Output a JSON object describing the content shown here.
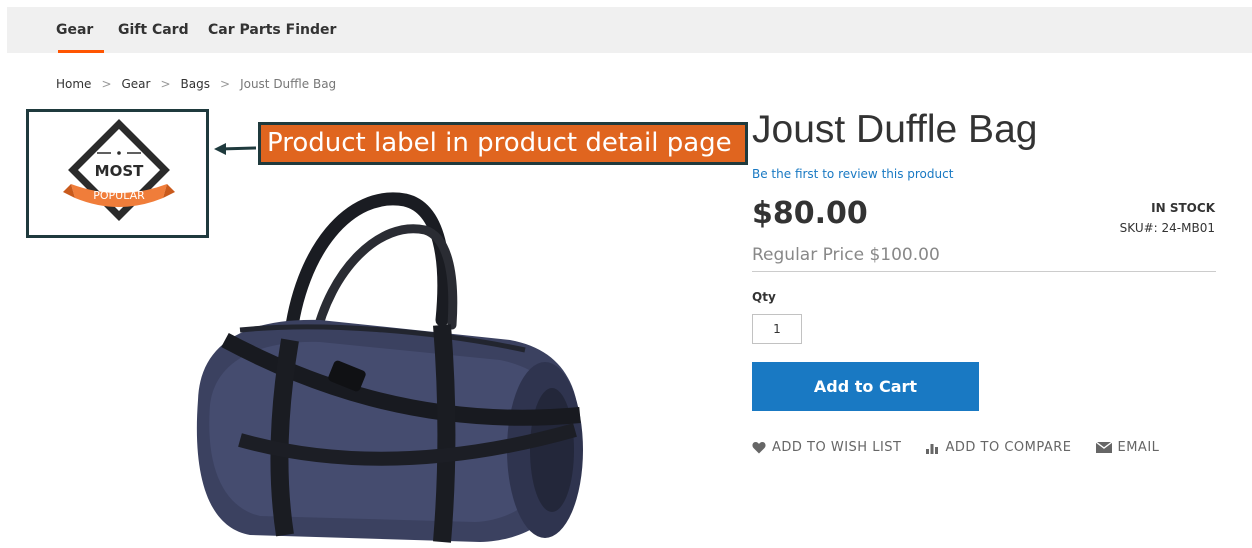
{
  "nav": {
    "items": [
      {
        "label": "Gear"
      },
      {
        "label": "Gift Card"
      },
      {
        "label": "Car Parts Finder"
      }
    ]
  },
  "breadcrumb": {
    "items": [
      "Home",
      "Gear",
      "Bags"
    ],
    "current": "Joust Duffle Bag",
    "separator": ">"
  },
  "label_badge": {
    "line1": "MOST",
    "line2": "POPULAR"
  },
  "callout": {
    "text": "Product label in product detail page"
  },
  "product": {
    "title": "Joust Duffle Bag",
    "review_link": "Be the first to review this product",
    "price": "$80.00",
    "regular_price": "Regular Price $100.00",
    "stock": "IN STOCK",
    "sku": "SKU#:  24-MB01",
    "qty_label": "Qty",
    "qty_value": "1",
    "add_to_cart": "Add to Cart"
  },
  "actions": {
    "wishlist": "ADD TO WISH LIST",
    "compare": "ADD TO COMPARE",
    "email": "EMAIL"
  },
  "colors": {
    "accent_orange": "#ff5501",
    "callout_orange": "#e0651f",
    "primary_blue": "#1979c3",
    "frame_dark": "#1f3a3d"
  }
}
